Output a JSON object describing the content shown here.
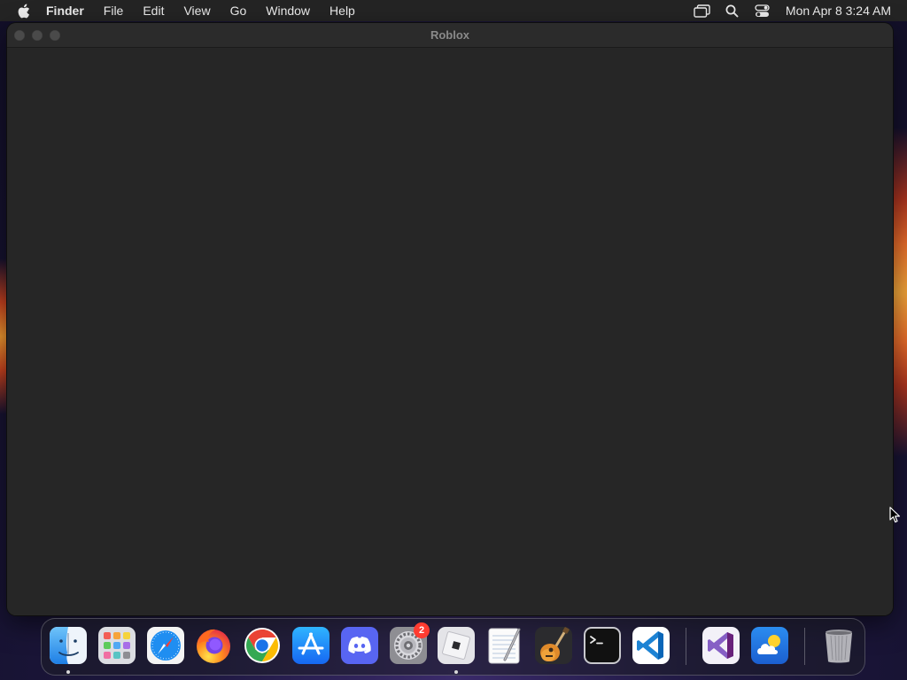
{
  "menubar": {
    "apple_icon": "apple-logo-icon",
    "app_name": "Finder",
    "menus": [
      "File",
      "Edit",
      "View",
      "Go",
      "Window",
      "Help"
    ],
    "status_icons": [
      "screen-mirroring-icon",
      "spotlight-search-icon",
      "control-center-icon"
    ],
    "clock": "Mon Apr 8  3:24 AM"
  },
  "window": {
    "title": "Roblox",
    "traffic_lights": [
      "close",
      "minimize",
      "zoom"
    ]
  },
  "dock": {
    "apps": [
      {
        "name": "Finder",
        "icon": "finder-icon",
        "running": true
      },
      {
        "name": "Launchpad",
        "icon": "launchpad-icon",
        "running": false
      },
      {
        "name": "Safari",
        "icon": "safari-icon",
        "running": false
      },
      {
        "name": "Firefox",
        "icon": "firefox-icon",
        "running": false
      },
      {
        "name": "Google Chrome",
        "icon": "chrome-icon",
        "running": false
      },
      {
        "name": "App Store",
        "icon": "app-store-icon",
        "running": false
      },
      {
        "name": "Discord",
        "icon": "discord-icon",
        "running": false
      },
      {
        "name": "System Settings",
        "icon": "system-settings-icon",
        "running": false,
        "badge": "2"
      },
      {
        "name": "Roblox",
        "icon": "roblox-icon",
        "running": true
      },
      {
        "name": "TextEdit",
        "icon": "textedit-icon",
        "running": false
      },
      {
        "name": "GarageBand",
        "icon": "garageband-icon",
        "running": false
      },
      {
        "name": "Terminal",
        "icon": "terminal-icon",
        "running": false
      },
      {
        "name": "Visual Studio Code",
        "icon": "vscode-icon",
        "running": false
      },
      {
        "name": "Visual Studio",
        "icon": "visual-studio-icon",
        "running": false
      },
      {
        "name": "Weather",
        "icon": "weather-icon",
        "running": false
      },
      {
        "name": "Trash",
        "icon": "trash-icon",
        "running": false
      }
    ]
  }
}
